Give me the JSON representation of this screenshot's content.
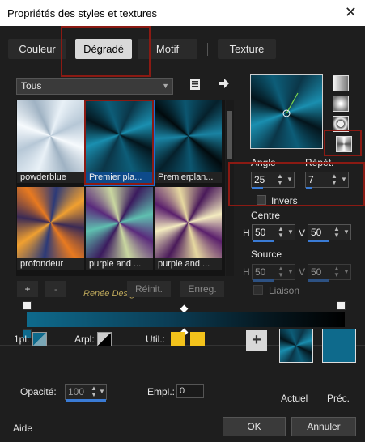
{
  "window": {
    "title": "Propriétés des styles et textures",
    "close": "✕"
  },
  "tabs": [
    "Couleur",
    "Dégradé",
    "Motif",
    "Texture"
  ],
  "library": {
    "dropdown_value": "Tous",
    "items": [
      "powderblue",
      "Premier pla...",
      "Premierplan...",
      "profondeur",
      "purple and ...",
      "purple and ..."
    ],
    "selected_index": 1
  },
  "buttons": {
    "add": "+",
    "remove": "-",
    "reset": "Réinit.",
    "save": "Enreg."
  },
  "watermark": "Renée Design",
  "params": {
    "angle_label": "Angle",
    "repeat_label": "Répét.",
    "angle": "25",
    "repeat": "7",
    "invert_label": "Invers",
    "center_label": "Centre",
    "center_h_label": "H",
    "center_h": "50",
    "center_v_label": "V",
    "center_v": "50",
    "source_label": "Source",
    "source_h_label": "H",
    "source_h": "50",
    "source_v_label": "V",
    "source_v": "50",
    "link_label": "Liaison"
  },
  "colors": {
    "fg_label": "1pl:",
    "bg_label": "Arpl:",
    "use_label": "Util.:",
    "opacity_label": "Opacité:",
    "opacity": "100",
    "location_label": "Empl.:",
    "location": "0",
    "accent": "#0e6a8c",
    "yellow": "#f2c21b"
  },
  "preview": {
    "current_label": "Actuel",
    "previous_label": "Préc."
  },
  "footer": {
    "help": "Aide",
    "ok": "OK",
    "cancel": "Annuler"
  }
}
